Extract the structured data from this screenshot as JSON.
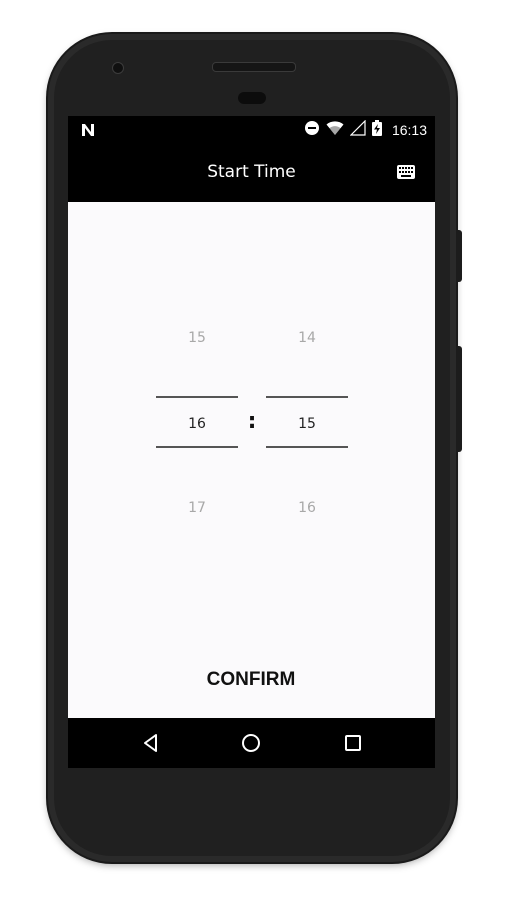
{
  "status_bar": {
    "time": "16:13",
    "icons": [
      "notification-n-icon",
      "do-not-disturb-icon",
      "wifi-icon",
      "signal-icon",
      "battery-charging-icon"
    ]
  },
  "app_bar": {
    "title": "Start Time",
    "keyboard_icon": "keyboard-icon"
  },
  "time_picker": {
    "hours": {
      "prev": "15",
      "current": "16",
      "next": "17"
    },
    "separator": ":",
    "minutes": {
      "prev": "14",
      "current": "15",
      "next": "16"
    }
  },
  "actions": {
    "confirm_label": "CONFIRM"
  },
  "nav_bar": {
    "buttons": [
      "back-icon",
      "home-icon",
      "recents-icon"
    ]
  },
  "colors": {
    "screen_background": "#fbfafc",
    "bar_background": "#000000",
    "inactive_text": "#a8a8a8",
    "active_text": "#222222"
  }
}
